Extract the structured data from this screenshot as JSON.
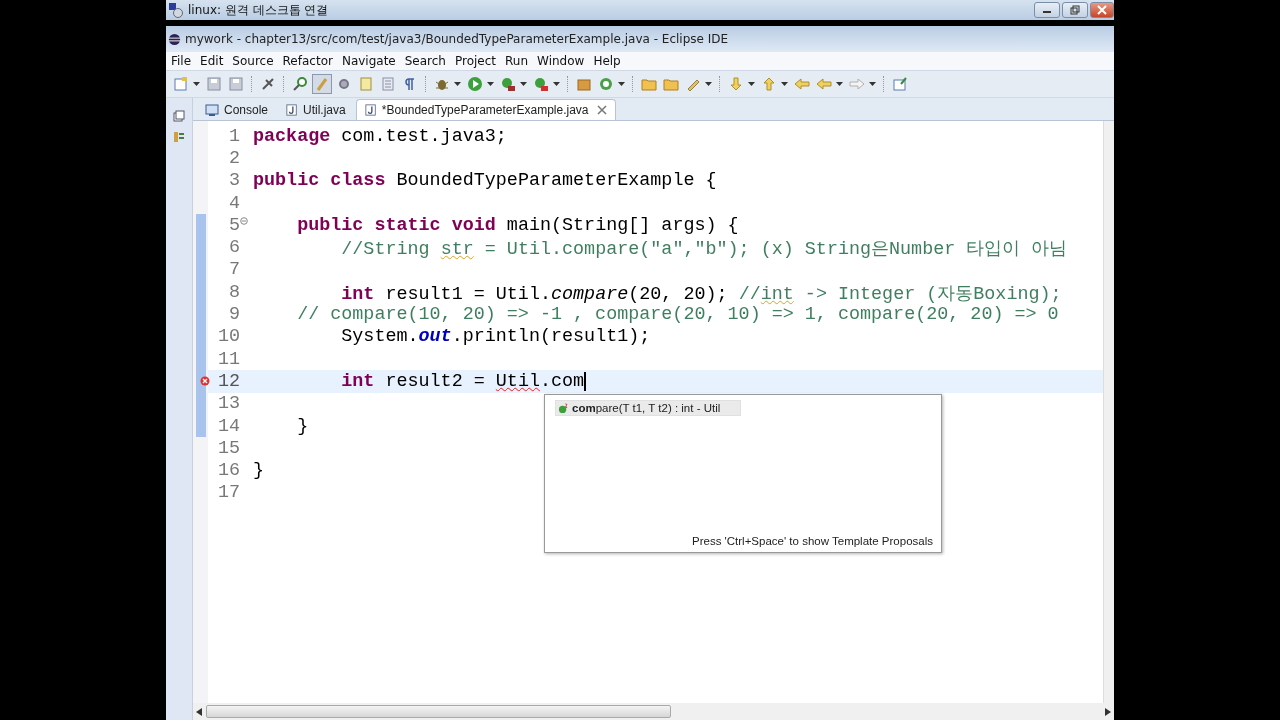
{
  "remote_window": {
    "title": "linux: 원격 데스크톱 연결"
  },
  "window": {
    "title": "mywork - chapter13/src/com/test/java3/BoundedTypeParameterExample.java - Eclipse IDE"
  },
  "menu": [
    "File",
    "Edit",
    "Source",
    "Refactor",
    "Navigate",
    "Search",
    "Project",
    "Run",
    "Window",
    "Help"
  ],
  "tabs": [
    {
      "label": "Console",
      "kind": "console",
      "selected": false
    },
    {
      "label": "Util.java",
      "kind": "java",
      "selected": false
    },
    {
      "label": "*BoundedTypeParameterExample.java",
      "kind": "java",
      "selected": true
    }
  ],
  "editor": {
    "lines": [
      {
        "number": "1",
        "changed": false,
        "current": false,
        "foldable": false,
        "error": false,
        "segments": [
          {
            "kind": "keyword",
            "text": "package "
          },
          {
            "kind": "text",
            "text": "com.test.java3;"
          }
        ]
      },
      {
        "number": "2",
        "changed": false,
        "current": false,
        "foldable": false,
        "error": false
      },
      {
        "number": "3",
        "changed": false,
        "current": false,
        "foldable": false,
        "error": false,
        "segments": [
          {
            "kind": "keyword",
            "text": "public class "
          },
          {
            "kind": "text",
            "text": "BoundedTypeParameterExample {"
          }
        ]
      },
      {
        "number": "4",
        "changed": false,
        "current": false,
        "foldable": false,
        "error": false
      },
      {
        "number": "5",
        "changed": true,
        "current": false,
        "foldable": true,
        "error": false,
        "segments": [
          {
            "kind": "keyword",
            "text": "    public static void "
          },
          {
            "kind": "text",
            "text": "main(String[] args) {"
          }
        ]
      },
      {
        "number": "6",
        "changed": true,
        "current": false,
        "foldable": false,
        "error": false,
        "segments": [
          {
            "kind": "comment",
            "text": "        //String "
          },
          {
            "kind": "comment_warning",
            "text": "str"
          },
          {
            "kind": "comment",
            "text": " = Util.compare(\"a\",\"b\"); (x) String은Number 타입이 아님"
          }
        ]
      },
      {
        "number": "7",
        "changed": true,
        "current": false,
        "foldable": false,
        "error": false
      },
      {
        "number": "8",
        "changed": true,
        "current": false,
        "foldable": false,
        "error": false,
        "segments": [
          {
            "kind": "keyword",
            "text": "        int "
          },
          {
            "kind": "text",
            "text": "result1 = Util."
          },
          {
            "kind": "static",
            "text": "compare"
          },
          {
            "kind": "text",
            "text": "(20, 20); "
          },
          {
            "kind": "comment",
            "text": "//"
          },
          {
            "kind": "comment_warning",
            "text": "int"
          },
          {
            "kind": "comment",
            "text": " -> Integer (자동Boxing);"
          }
        ]
      },
      {
        "number": "9",
        "changed": true,
        "current": false,
        "foldable": false,
        "error": false,
        "segments": [
          {
            "kind": "comment",
            "text": "    // compare(10, 20) => -1 , compare(20, 10) => 1, compare(20, 20) => 0"
          }
        ]
      },
      {
        "number": "10",
        "changed": true,
        "current": false,
        "foldable": false,
        "error": false,
        "segments": [
          {
            "kind": "text",
            "text": "        System."
          },
          {
            "kind": "field",
            "text": "out"
          },
          {
            "kind": "text",
            "text": ".println(result1);"
          }
        ]
      },
      {
        "number": "11",
        "changed": true,
        "current": false,
        "foldable": false,
        "error": false
      },
      {
        "number": "12",
        "changed": true,
        "current": true,
        "foldable": false,
        "error": true,
        "segments": [
          {
            "kind": "keyword",
            "text": "        int "
          },
          {
            "kind": "text",
            "text": "result2 = "
          },
          {
            "kind": "error",
            "text": "Util"
          },
          {
            "kind": "text",
            "text": ".com"
          }
        ]
      },
      {
        "number": "13",
        "changed": true,
        "current": false,
        "foldable": false,
        "error": false
      },
      {
        "number": "14",
        "changed": true,
        "current": false,
        "foldable": false,
        "error": false,
        "segments": [
          {
            "kind": "text",
            "text": "    }"
          }
        ]
      },
      {
        "number": "15",
        "changed": false,
        "current": false,
        "foldable": false,
        "error": false
      },
      {
        "number": "16",
        "changed": false,
        "current": false,
        "foldable": false,
        "error": false,
        "segments": [
          {
            "kind": "text",
            "text": "}"
          }
        ]
      },
      {
        "number": "17",
        "changed": false,
        "current": false,
        "foldable": false,
        "error": false
      }
    ]
  },
  "content_assist": {
    "proposals": [
      {
        "label": "**com**pare(T t1, T t2) : int - Util",
        "selected": true
      }
    ],
    "footer": "Press 'Ctrl+Space' to show Template Proposals"
  }
}
